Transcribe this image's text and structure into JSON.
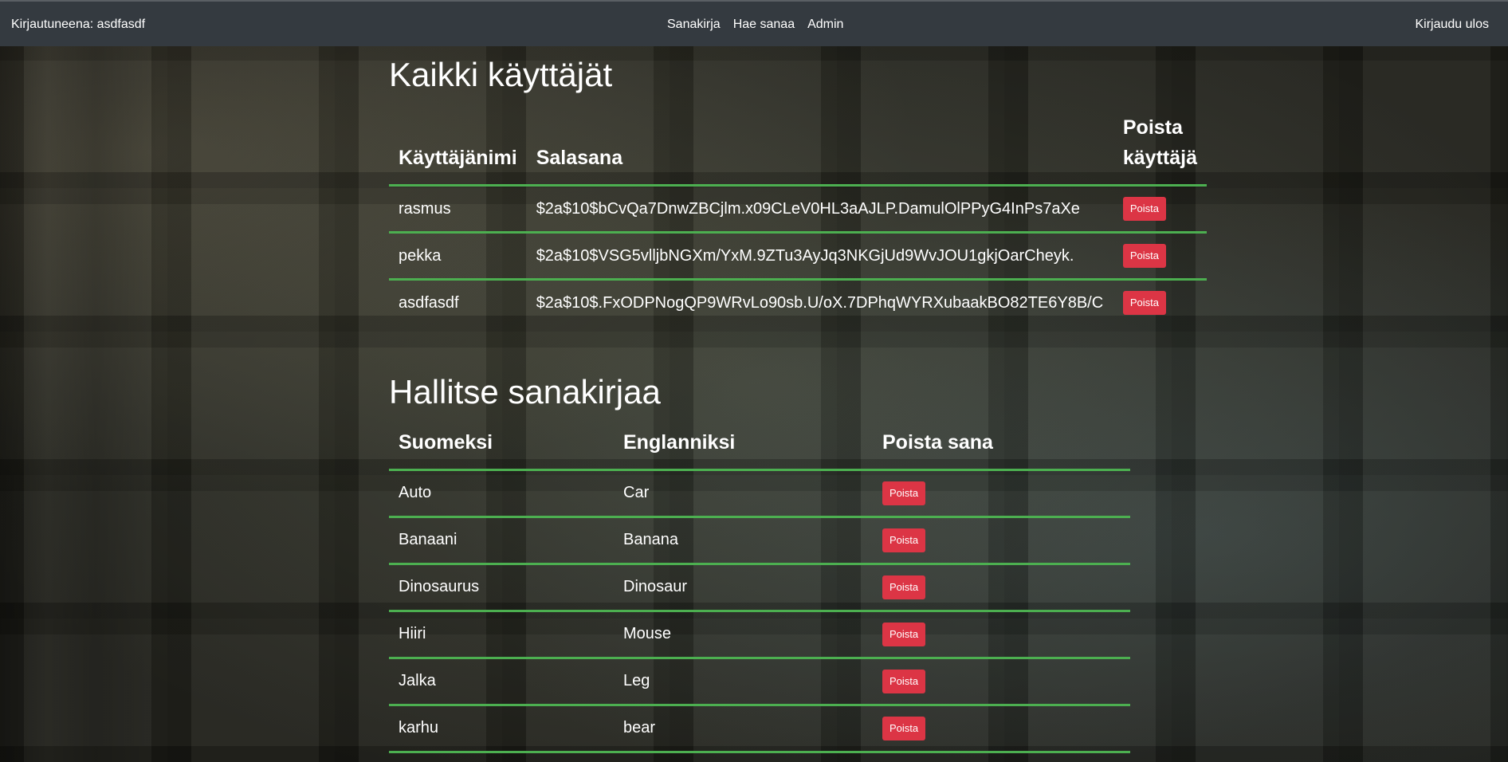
{
  "navbar": {
    "logged_in_as": "Kirjautuneena: asdfasdf",
    "links": [
      "Sanakirja",
      "Hae sanaa",
      "Admin"
    ],
    "logout": "Kirjaudu ulos"
  },
  "users_section": {
    "title": "Kaikki käyttäjät",
    "headers": {
      "username": "Käyttäjänimi",
      "password": "Salasana",
      "delete_line1": "Poista",
      "delete_line2": "käyttäjä"
    },
    "rows": [
      {
        "username": "rasmus",
        "password": "$2a$10$bCvQa7DnwZBCjlm.x09CLeV0HL3aAJLP.DamulOlPPyG4InPs7aXe",
        "button": "Poista"
      },
      {
        "username": "pekka",
        "password": "$2a$10$VSG5vlljbNGXm/YxM.9ZTu3AyJq3NKGjUd9WvJOU1gkjOarCheyk.",
        "button": "Poista"
      },
      {
        "username": "asdfasdf",
        "password": "$2a$10$.FxODPNogQP9WRvLo90sb.U/oX.7DPhqWYRXubaakBO82TE6Y8B/C",
        "button": "Poista"
      }
    ]
  },
  "dictionary_section": {
    "title": "Hallitse sanakirjaa",
    "headers": {
      "finnish": "Suomeksi",
      "english": "Englanniksi",
      "delete": "Poista sana"
    },
    "rows": [
      {
        "finnish": "Auto",
        "english": "Car",
        "button": "Poista"
      },
      {
        "finnish": "Banaani",
        "english": "Banana",
        "button": "Poista"
      },
      {
        "finnish": "Dinosaurus",
        "english": "Dinosaur",
        "button": "Poista"
      },
      {
        "finnish": "Hiiri",
        "english": "Mouse",
        "button": "Poista"
      },
      {
        "finnish": "Jalka",
        "english": "Leg",
        "button": "Poista"
      },
      {
        "finnish": "karhu",
        "english": "bear",
        "button": "Poista"
      }
    ]
  },
  "colors": {
    "navbar_bg": "#343a40",
    "row_border": "#4caf50",
    "danger_button": "#dc3545"
  }
}
